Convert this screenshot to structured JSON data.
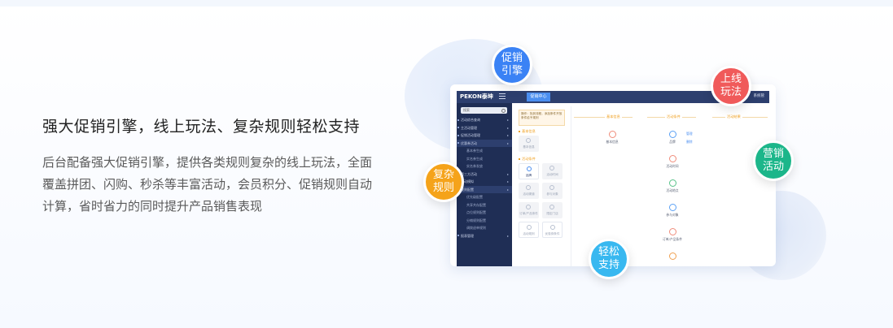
{
  "headline": "强大促销引擎，线上玩法、复杂规则轻松支持",
  "description_lines": [
    "后台配备强大促销引擎，提供各类规则复杂的线上玩法，全面",
    "覆盖拼团、闪购、秒杀等丰富活动，会员积分、促销规则自动",
    "计算，省时省力的同时提升产品销售表现"
  ],
  "bubbles": {
    "promo_engine": "促销\n引擎",
    "online_play": "上线\n玩法",
    "complex_rules": "复杂\n规则",
    "marketing": "营销\n活动",
    "easy_support": "轻松\n支持"
  },
  "colors": {
    "promo_engine": "#3a82f5",
    "online_play": "#f05a5a",
    "complex_rules": "#f5a31a",
    "marketing": "#1cb68a",
    "easy_support": "#38b8f0"
  },
  "app": {
    "logo": "PEKON泰坤",
    "active_tab": "促销中心",
    "user": "系统管",
    "search_placeholder": "搜索",
    "sidebar": [
      {
        "label": "活动综合查询",
        "type": "item"
      },
      {
        "label": "主活动管理",
        "type": "item"
      },
      {
        "label": "促销活动管理",
        "type": "item"
      },
      {
        "label": "优惠券活动",
        "type": "item"
      },
      {
        "label": "基本券生成",
        "type": "sub"
      },
      {
        "label": "实名券生成",
        "type": "sub"
      },
      {
        "label": "实名券发放",
        "type": "sub"
      },
      {
        "label": "第三方活动",
        "type": "item"
      },
      {
        "label": "活动模拟",
        "type": "item"
      },
      {
        "label": "规则配置",
        "type": "item"
      },
      {
        "label": "优先级配置",
        "type": "sub"
      },
      {
        "label": "共享共存配置",
        "type": "sub"
      },
      {
        "label": "点位规则配置",
        "type": "sub"
      },
      {
        "label": "分摊规则配置",
        "type": "sub"
      },
      {
        "label": "调拨退单规则",
        "type": "sub"
      },
      {
        "label": "报表管理",
        "type": "item"
      }
    ],
    "notice": "操作：找到流程，添加条件开放条件给予规则",
    "sections": {
      "basic": "基本信息",
      "conditions": "活动条件"
    },
    "cards": {
      "basic_info": "基本信息",
      "brand": "品牌",
      "time": "活动时间",
      "channel": "活动渠道",
      "member": "参与对象",
      "order": "订单/产品条件",
      "limit": "限定门店",
      "rule": "活动规则",
      "coupon": "优惠券条件"
    },
    "steps": {
      "basic": "基本信息",
      "conditions": "活动条件",
      "result": "活动结果"
    },
    "nodes": {
      "basic": "基本信息",
      "brand": "品牌",
      "time": "活动时间",
      "place": "活动地点",
      "member": "参与对象",
      "order": "订单/产品条件"
    },
    "links": {
      "manage": "管理",
      "delete": "删除"
    }
  }
}
